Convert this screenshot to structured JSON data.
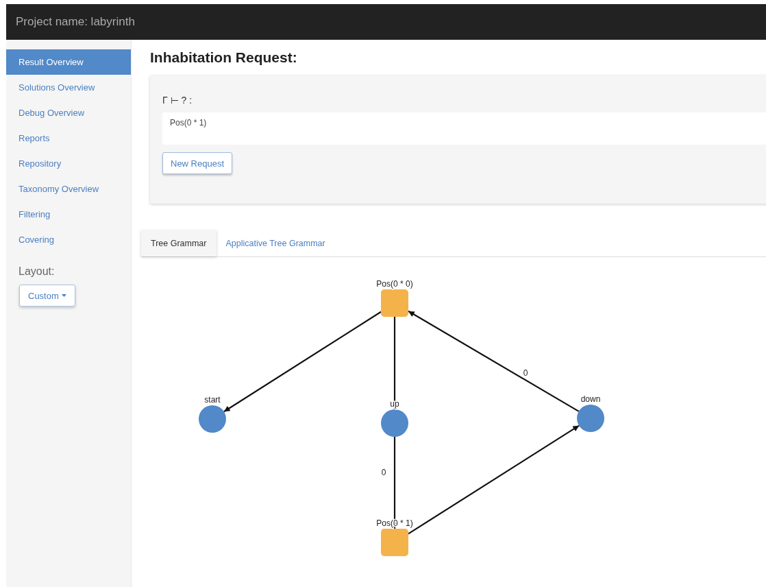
{
  "header": {
    "title": "Project name: labyrinth"
  },
  "sidebar": {
    "items": [
      {
        "label": "Result Overview",
        "selected": true
      },
      {
        "label": "Solutions Overview",
        "selected": false
      },
      {
        "label": "Debug Overview",
        "selected": false
      },
      {
        "label": "Reports",
        "selected": false
      },
      {
        "label": "Repository",
        "selected": false
      },
      {
        "label": "Taxonomy Overview",
        "selected": false
      },
      {
        "label": "Filtering",
        "selected": false
      },
      {
        "label": "Covering",
        "selected": false
      }
    ],
    "layout_label": "Layout:",
    "layout_dropdown": "Custom"
  },
  "heading": "Inhabitation Request:",
  "request": {
    "label": "Γ ⊢ ? :",
    "value": "Pos(0 * 1)",
    "button": "New Request"
  },
  "tabs": [
    {
      "label": "Tree Grammar",
      "selected": true
    },
    {
      "label": "Applicative Tree Grammar",
      "selected": false
    }
  ],
  "graph": {
    "nodes": [
      {
        "label": "Pos(0 * 0)",
        "kind": "type"
      },
      {
        "label": "start",
        "kind": "combinator"
      },
      {
        "label": "up",
        "kind": "combinator"
      },
      {
        "label": "down",
        "kind": "combinator"
      },
      {
        "label": "Pos(0 * 1)",
        "kind": "type"
      }
    ],
    "edge_labels": [
      "0",
      "0"
    ]
  }
}
